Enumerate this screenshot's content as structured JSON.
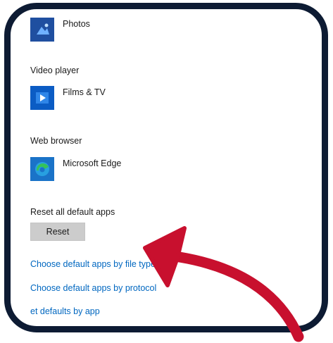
{
  "apps": {
    "photos": {
      "name": "Photos",
      "icon": "photos-icon"
    },
    "video_player": {
      "heading": "Video player",
      "name": "Films & TV",
      "icon": "films-tv-icon"
    },
    "web_browser": {
      "heading": "Web browser",
      "name": "Microsoft Edge",
      "icon": "microsoft-edge-icon"
    }
  },
  "reset": {
    "heading": "Reset all default apps",
    "button_label": "Reset"
  },
  "links": {
    "by_file_type": "Choose default apps by file type",
    "by_protocol": "Choose default apps by protocol",
    "by_app": "et defaults by app"
  },
  "colors": {
    "frame": "#0d1b33",
    "link": "#0067c0",
    "arrow": "#c8102e",
    "button": "#cccccc"
  }
}
